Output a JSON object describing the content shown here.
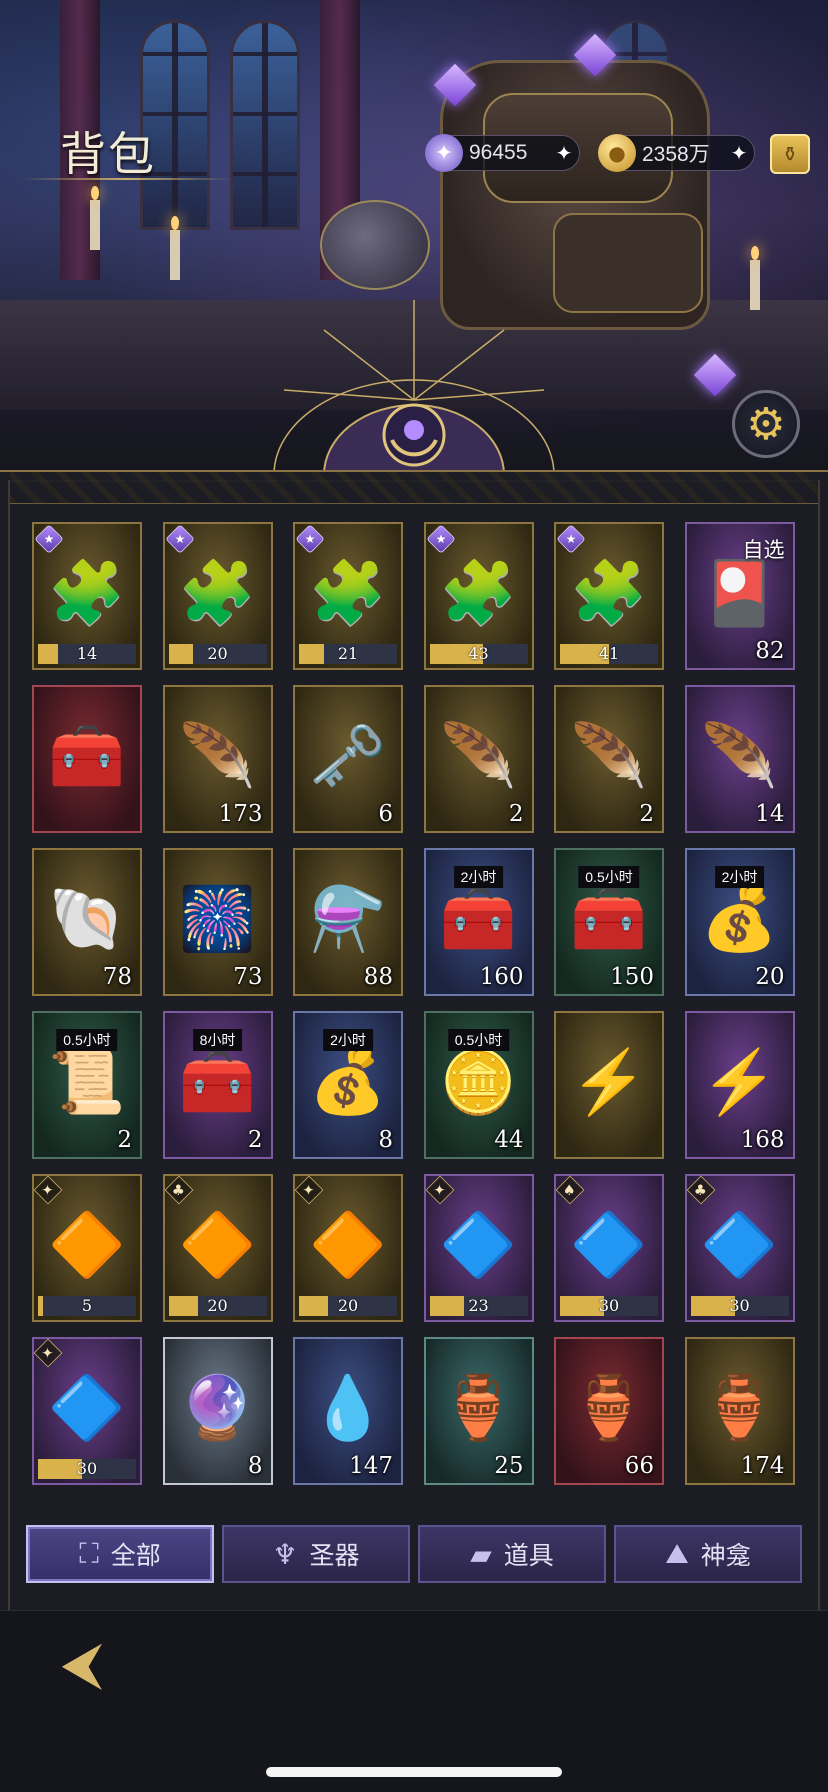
{
  "header": {
    "title": "背包",
    "currencies": [
      {
        "icon": "star-gem-icon",
        "value": "96455"
      },
      {
        "icon": "gold-coin-icon",
        "value": "2358万"
      }
    ]
  },
  "items": [
    {
      "art": "🧩",
      "rarity": "gold",
      "corner": "star",
      "progress": {
        "value": "14",
        "fill": 0.2
      }
    },
    {
      "art": "🧩",
      "rarity": "gold",
      "corner": "star",
      "progress": {
        "value": "20",
        "fill": 0.25
      }
    },
    {
      "art": "🧩",
      "rarity": "gold",
      "corner": "star",
      "progress": {
        "value": "21",
        "fill": 0.25
      }
    },
    {
      "art": "🧩",
      "rarity": "gold",
      "corner": "star",
      "progress": {
        "value": "43",
        "fill": 0.55
      }
    },
    {
      "art": "🧩",
      "rarity": "gold",
      "corner": "star",
      "progress": {
        "value": "41",
        "fill": 0.5
      }
    },
    {
      "art": "🎴",
      "rarity": "purple",
      "badge": "自选",
      "qty": "82"
    },
    {
      "art": "🧰",
      "rarity": "red"
    },
    {
      "art": "🪶",
      "rarity": "gold",
      "qty": "173"
    },
    {
      "art": "🗝️",
      "rarity": "gold",
      "qty": "6"
    },
    {
      "art": "🪶",
      "rarity": "gold",
      "qty": "2"
    },
    {
      "art": "🪶",
      "rarity": "gold",
      "qty": "2"
    },
    {
      "art": "🪶",
      "rarity": "purple",
      "qty": "14"
    },
    {
      "art": "🐚",
      "rarity": "gold",
      "qty": "78"
    },
    {
      "art": "🎆",
      "rarity": "gold",
      "qty": "73"
    },
    {
      "art": "⚗️",
      "rarity": "gold",
      "qty": "88"
    },
    {
      "art": "🧰",
      "rarity": "blue",
      "timer": "2小时",
      "qty": "160"
    },
    {
      "art": "🧰",
      "rarity": "green",
      "timer": "0.5小时",
      "qty": "150"
    },
    {
      "art": "💰",
      "rarity": "blue",
      "timer": "2小时",
      "qty": "20"
    },
    {
      "art": "📜",
      "rarity": "green",
      "timer": "0.5小时",
      "qty": "2"
    },
    {
      "art": "🧰",
      "rarity": "purple",
      "timer": "8小时",
      "qty": "2"
    },
    {
      "art": "💰",
      "rarity": "blue",
      "timer": "2小时",
      "qty": "8"
    },
    {
      "art": "🪙",
      "rarity": "green",
      "timer": "0.5小时",
      "qty": "44"
    },
    {
      "art": "⚡",
      "rarity": "gold"
    },
    {
      "art": "⚡",
      "rarity": "purple",
      "qty": "168"
    },
    {
      "art": "🔶",
      "rarity": "gold",
      "corner": "suit",
      "suit": "✦",
      "progress": {
        "value": "5",
        "fill": 0.05
      }
    },
    {
      "art": "🔶",
      "rarity": "gold",
      "corner": "suit",
      "suit": "♣",
      "progress": {
        "value": "20",
        "fill": 0.3
      }
    },
    {
      "art": "🔶",
      "rarity": "gold",
      "corner": "suit",
      "suit": "✦",
      "progress": {
        "value": "20",
        "fill": 0.3
      }
    },
    {
      "art": "🔷",
      "rarity": "purple",
      "corner": "suit",
      "suit": "✦",
      "progress": {
        "value": "23",
        "fill": 0.35
      }
    },
    {
      "art": "🔷",
      "rarity": "purple",
      "corner": "suit",
      "suit": "♠",
      "progress": {
        "value": "30",
        "fill": 0.45
      }
    },
    {
      "art": "🔷",
      "rarity": "purple",
      "corner": "suit",
      "suit": "♣",
      "progress": {
        "value": "30",
        "fill": 0.45
      }
    },
    {
      "art": "🔷",
      "rarity": "purple",
      "corner": "suit",
      "suit": "✦",
      "progress": {
        "value": "30",
        "fill": 0.45
      }
    },
    {
      "art": "🔮",
      "rarity": "silver",
      "qty": "8"
    },
    {
      "art": "💧",
      "rarity": "blue",
      "qty": "147"
    },
    {
      "art": "🏺",
      "rarity": "teal",
      "qty": "25"
    },
    {
      "art": "🏺",
      "rarity": "red",
      "qty": "66"
    },
    {
      "art": "🏺",
      "rarity": "gold",
      "qty": "174"
    }
  ],
  "tabs": [
    {
      "label": "全部",
      "icon": "grid-icon",
      "glyph": "⛶",
      "active": true
    },
    {
      "label": "圣器",
      "icon": "chalice-icon",
      "glyph": "♆",
      "active": false
    },
    {
      "label": "道具",
      "icon": "ingots-icon",
      "glyph": "▰",
      "active": false
    },
    {
      "label": "神龛",
      "icon": "shrine-icon",
      "glyph": "⛰",
      "active": false
    }
  ],
  "colors": {
    "accent_gold": "#c9ad6a",
    "tab_active": "#4b4585",
    "tab_inactive": "#2b2548"
  }
}
